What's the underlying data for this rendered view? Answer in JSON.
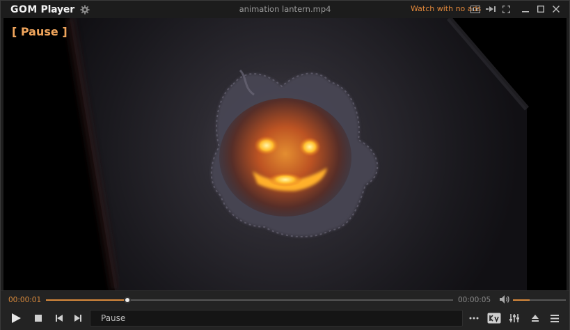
{
  "app": {
    "name_part1": "GOM",
    "name_part2": "Player",
    "filename": "animation lantern.mp4",
    "ads_text": "Watch with no ads"
  },
  "titlebar_icons": [
    "subtitle-icon",
    "playlist-mini-icon",
    "fullscreen-icon",
    "minimize-icon",
    "maximize-icon",
    "close-icon"
  ],
  "video": {
    "osd_text": "[ Pause ]"
  },
  "playback": {
    "current_time": "00:00:01",
    "total_time": "00:00:05",
    "progress": 0.2,
    "volume": 0.32,
    "status_text": "Pause"
  },
  "colors": {
    "accent": "#d98a3c",
    "osd": "#f0a55c",
    "background": "#1e1e1e"
  }
}
